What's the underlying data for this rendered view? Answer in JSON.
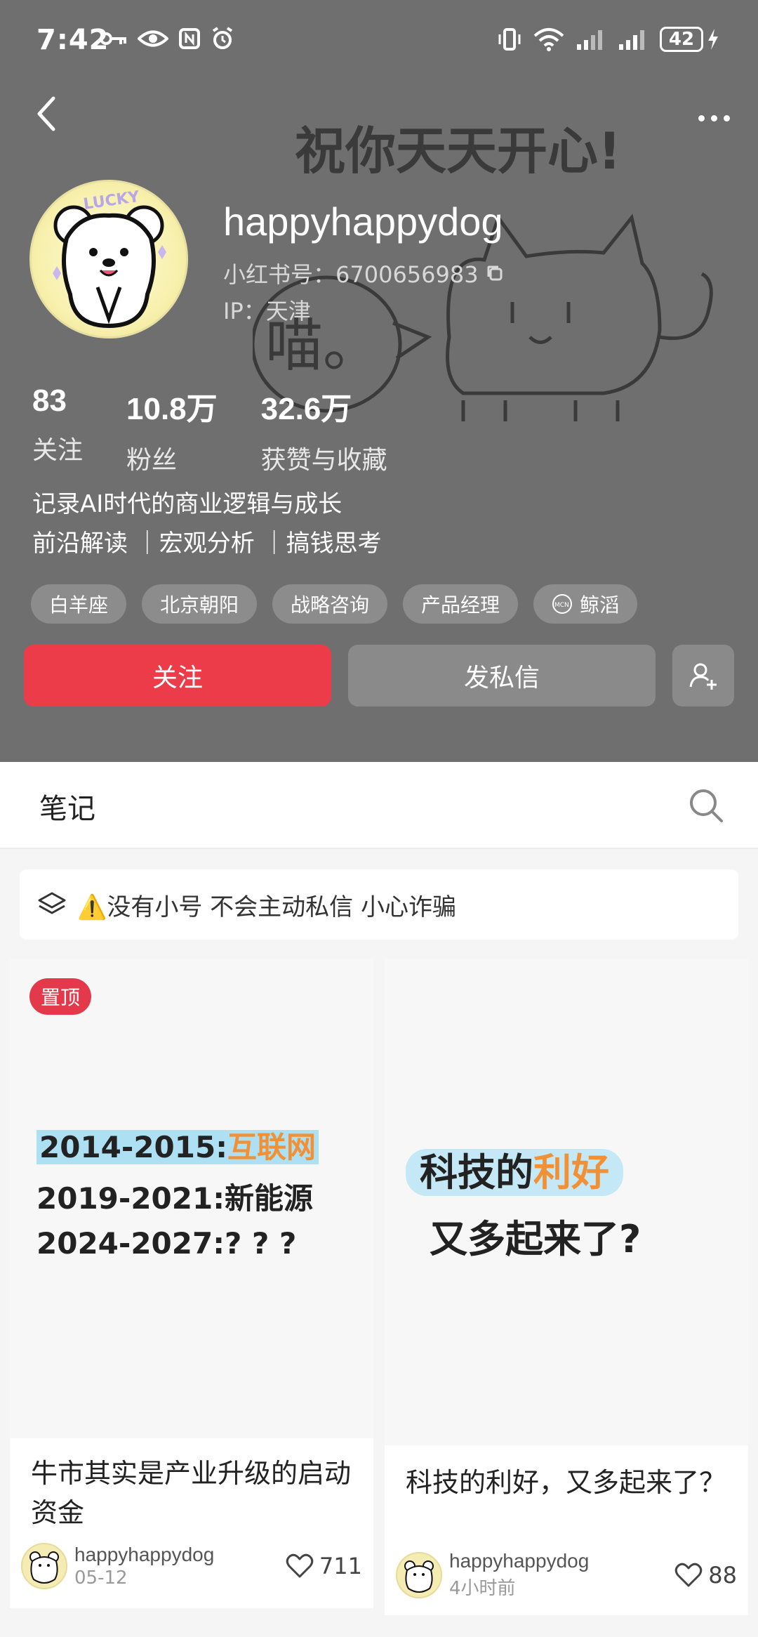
{
  "status_bar": {
    "time": "7:42",
    "battery_level": "42"
  },
  "profile": {
    "username": "happyhappydog",
    "redbook_id": "小红书号：6700656983",
    "ip": "IP：天津",
    "background_art_text": "祝你天天开心!",
    "background_art_bubble": "喵。",
    "avatar_text": "LUCKY",
    "stats": [
      {
        "value": "83",
        "label": "关注"
      },
      {
        "value": "10.8万",
        "label": "粉丝"
      },
      {
        "value": "32.6万",
        "label": "获赞与收藏"
      }
    ],
    "bio_line1": "记录AI时代的商业逻辑与成长",
    "bio_line2": "前沿解读 ｜宏观分析 ｜搞钱思考",
    "tags": [
      "白羊座",
      "北京朝阳",
      "战略咨询",
      "产品经理",
      "鲸滔"
    ],
    "follow_label": "关注",
    "message_label": "发私信"
  },
  "tabs": {
    "notes_label": "笔记"
  },
  "notice": {
    "text": "⚠️没有小号 不会主动私信 小心诈骗"
  },
  "cards": [
    {
      "pin_label": "置顶",
      "cover_line1_a": "2014-2015:",
      "cover_line1_b": "互联网",
      "cover_line2": "2019-2021:新能源",
      "cover_line3": "2024-2027:? ? ?",
      "title": "牛市其实是产业升级的启动资金",
      "author": "happyhappydog",
      "date": "05-12",
      "likes": "711"
    },
    {
      "cover_line1_a": "科技的",
      "cover_line1_b": "利好",
      "cover_line2": "又多起来了?",
      "title": "科技的利好，又多起来了？",
      "author": "happyhappydog",
      "date": "4小时前",
      "likes": "88"
    }
  ],
  "colors": {
    "header_bg": "#6f6f6f",
    "follow_red": "#ec3c4a",
    "accent_orange": "#f19034"
  }
}
